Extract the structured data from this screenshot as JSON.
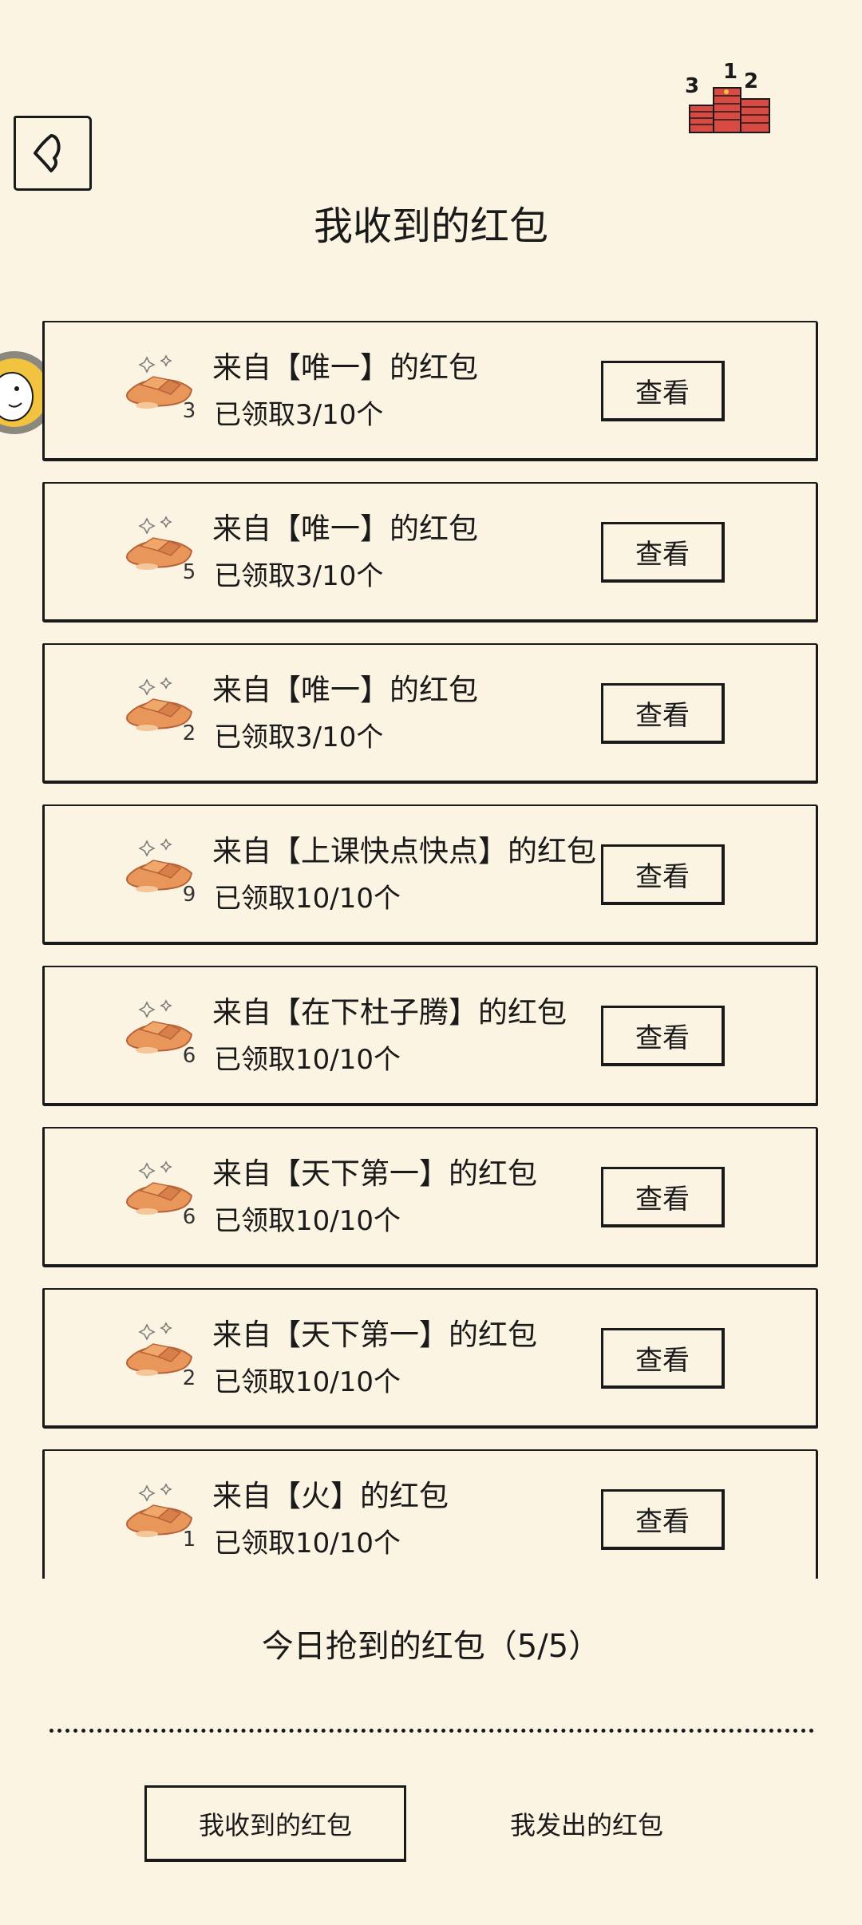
{
  "header": {
    "title": "我收到的红包",
    "back_icon": "back-arrow-icon",
    "decoration": {
      "icon": "red-envelope-stack-icon",
      "numbers": [
        "3",
        "1",
        "2"
      ]
    }
  },
  "packets": [
    {
      "title": "来自【唯一】的红包",
      "progress": "已领取3/10个",
      "count": "3",
      "button": "查看"
    },
    {
      "title": "来自【唯一】的红包",
      "progress": "已领取3/10个",
      "count": "5",
      "button": "查看"
    },
    {
      "title": "来自【唯一】的红包",
      "progress": "已领取3/10个",
      "count": "2",
      "button": "查看"
    },
    {
      "title": "来自【上课快点快点】的红包",
      "progress": "已领取10/10个",
      "count": "9",
      "button": "查看"
    },
    {
      "title": "来自【在下杜子腾】的红包",
      "progress": "已领取10/10个",
      "count": "6",
      "button": "查看"
    },
    {
      "title": "来自【天下第一】的红包",
      "progress": "已领取10/10个",
      "count": "6",
      "button": "查看"
    },
    {
      "title": "来自【天下第一】的红包",
      "progress": "已领取10/10个",
      "count": "2",
      "button": "查看"
    },
    {
      "title": "来自【火】的红包",
      "progress": "已领取10/10个",
      "count": "1",
      "button": "查看"
    }
  ],
  "today": {
    "text": "今日抢到的红包（5/5）"
  },
  "tabs": {
    "received": "我收到的红包",
    "sent": "我发出的红包"
  },
  "colors": {
    "background": "#fbf4e3",
    "ink": "#1a1a1a",
    "ingot": "#e8965a",
    "envelope_red": "#d94a43"
  }
}
